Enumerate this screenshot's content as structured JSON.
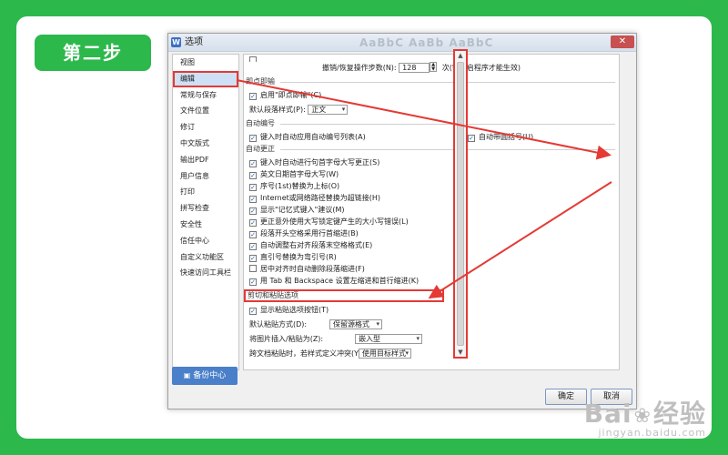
{
  "step_label": "第二步",
  "dialog": {
    "title": "选项",
    "app_icon_letter": "W",
    "ghost_style_preview": "AaBbC AaBb AaBbC",
    "close_glyph": "✕"
  },
  "nav": {
    "items": [
      "视图",
      "编辑",
      "常规与保存",
      "文件位置",
      "修订",
      "中文版式",
      "输出PDF",
      "用户信息",
      "打印",
      "拼写检查",
      "安全性",
      "信任中心",
      "自定义功能区",
      "快速访问工具栏"
    ],
    "active_index": 1
  },
  "backup_button": "备份中心",
  "content": {
    "undo_row": {
      "label": "撤销/恢复操作步数(N):",
      "value": "128",
      "note": "次(需重启程序才能生效)"
    },
    "click_and_type": {
      "title": "即点即输",
      "enable": "启用\"即点即输\"(C)",
      "default_style_label": "默认段落样式(P):",
      "default_style_value": "正文"
    },
    "auto_numbering": {
      "title": "自动编号",
      "apply_on_type": "键入时自动应用自动编号列表(A)",
      "auto_list": "自动带圆括号(U)"
    },
    "auto_correct": {
      "title": "自动更正",
      "items": [
        "键入时自动进行句首字母大写更正(S)",
        "英文日期首字母大写(W)",
        "序号(1st)替换为上标(O)",
        "Internet或网络路径替换为超链接(H)",
        "显示\"记忆式键入\"建议(M)",
        "更正意外使用大写锁定键产生的大小写错误(L)",
        "段落开头空格采用行首缩进(B)",
        "自动调整右对齐段落末空格格式(E)",
        "直引号替换为弯引号(R)",
        "居中对齐时自动删除段落缩进(F)",
        "用 Tab 和 Backspace 设置左缩进和首行缩进(K)"
      ],
      "checked": [
        true,
        true,
        true,
        true,
        true,
        true,
        true,
        true,
        true,
        false,
        true
      ]
    },
    "cut_paste": {
      "title": "剪切和粘贴选项",
      "show_button": "显示粘贴选项按钮(T)",
      "default_paste_label": "默认粘贴方式(D):",
      "default_paste_value": "保留源格式",
      "image_insert_label": "将图片插入/粘贴为(Z):",
      "image_insert_value": "嵌入型",
      "cross_doc_label": "跨文档粘贴时，若样式定义冲突(Y):",
      "cross_doc_value": "使用目标样式"
    }
  },
  "buttons": {
    "ok": "确定",
    "cancel": "取消"
  },
  "watermark": {
    "main_left": "Bai",
    "main_paw": "❀",
    "main_right": "经验",
    "sub": "jingyan.baidu.com"
  },
  "colors": {
    "accent_green": "#2db84c",
    "highlight_red": "#e53935",
    "nav_selected": "#cde0f5"
  }
}
